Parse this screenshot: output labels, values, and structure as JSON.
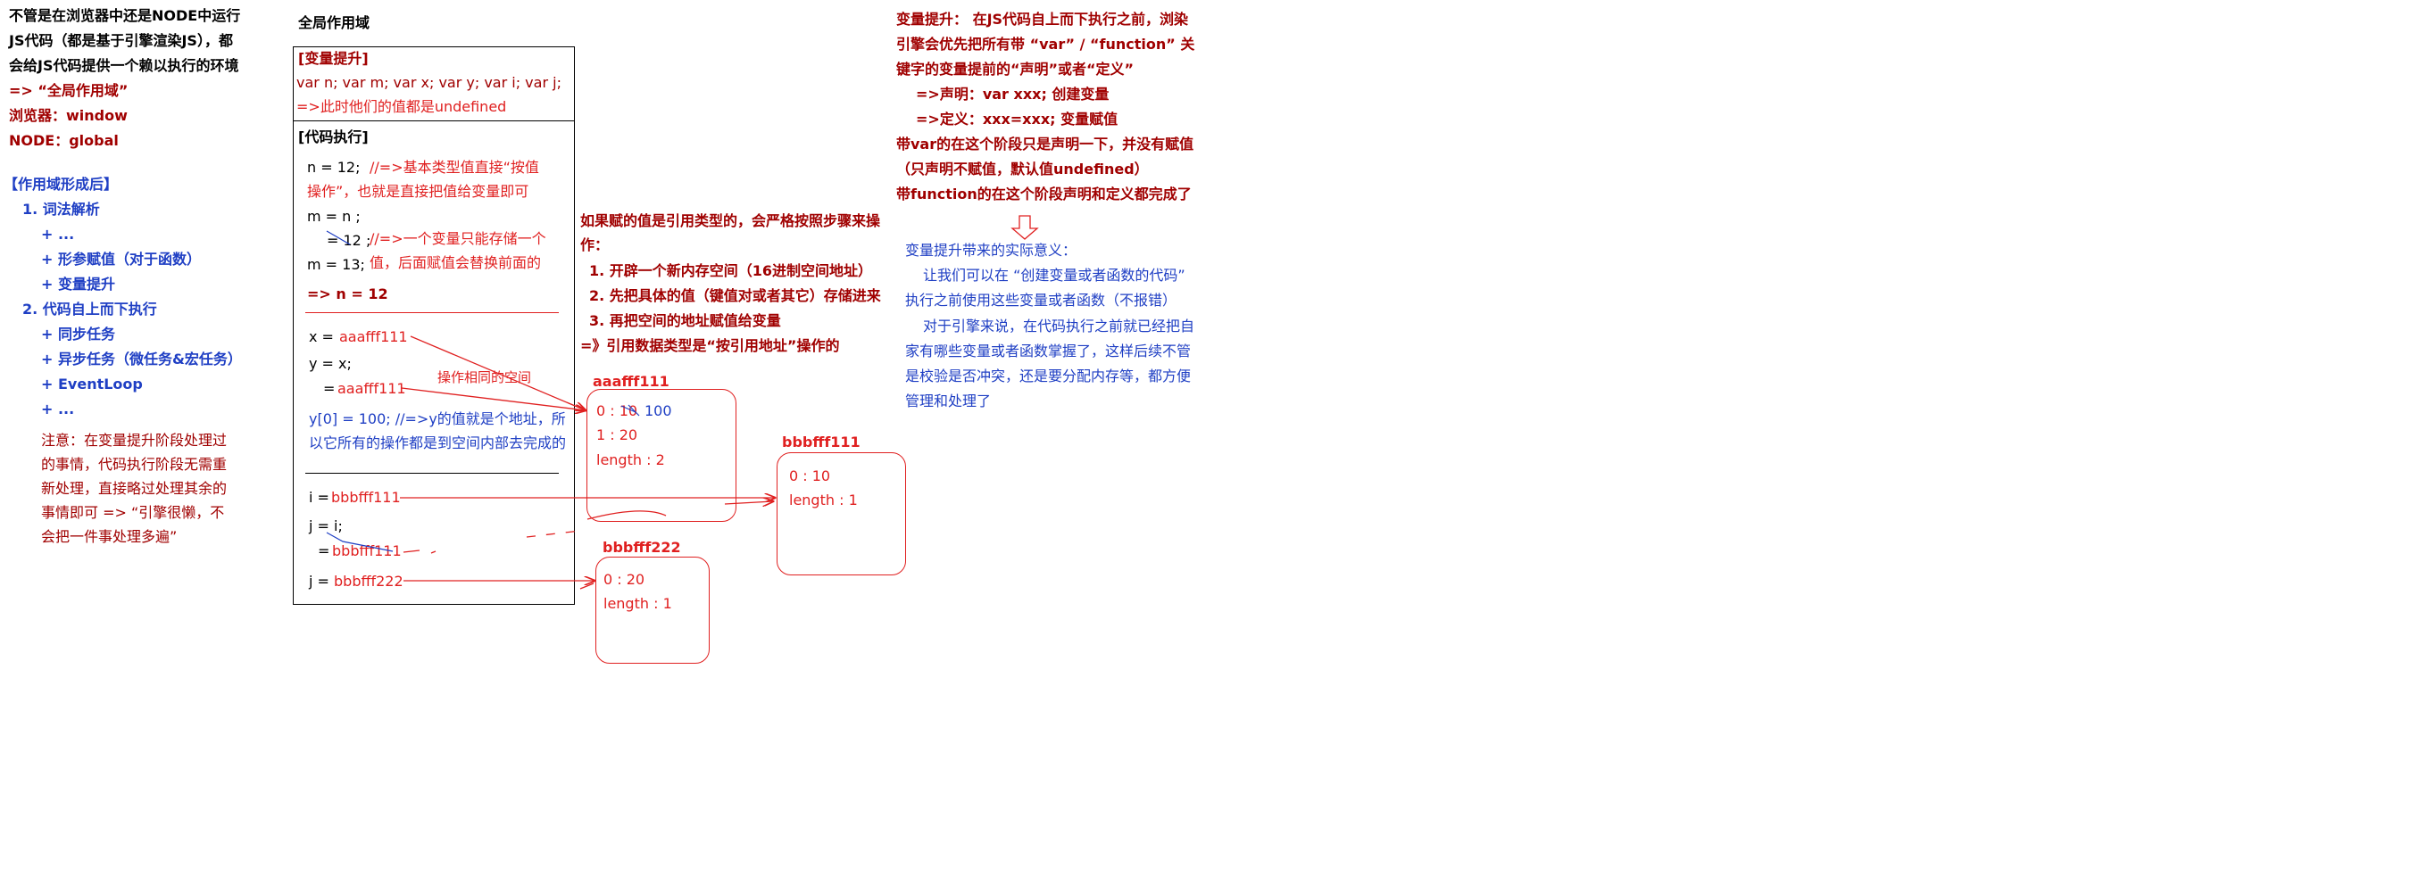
{
  "intro": {
    "lines": [
      "不管是在浏览器中还是NODE中运行",
      "JS代码（都是基于引擎渲染JS），都",
      "会给JS代码提供一个赖以执行的环境",
      "=> “全局作用域”",
      "浏览器：window",
      "NODE：global"
    ]
  },
  "after_scope": {
    "title": "【作用域形成后】",
    "items": [
      "1. 词法解析",
      "+ ...",
      "+ 形参赋值（对于函数）",
      "+ 变量提升",
      "2. 代码自上而下执行",
      "+ 同步任务",
      "+ 异步任务（微任务&宏任务）",
      "+ EventLoop",
      "+ ..."
    ],
    "note": [
      "注意：在变量提升阶段处理过",
      "的事情，代码执行阶段无需重",
      "新处理，直接略过处理其余的",
      "事情即可 => “引擎很懒，不",
      "会把一件事处理多遍”"
    ]
  },
  "global_scope": {
    "title": "全局作用域",
    "hoist_header": "[变量提升]",
    "hoist_line": "var n; var m; var x; var y; var i; var j;",
    "hoist_note": "=>此时他们的值都是undefined",
    "exec_header": "[代码执行]",
    "code": {
      "n_assign": "n = 12;",
      "n_comment_1": "//=>基本类型值直接“按值",
      "n_comment_2": "操作”，也就是直接把值给变量即可",
      "m_assign_1": "m = n ;",
      "m_assign_2": "= 12 ;",
      "m_comment_1": "//=>一个变量只能存储一个",
      "m_assign_3": "m = 13;",
      "m_comment_2": "值，后面赋值会替换前面的",
      "result": "=> n = 12",
      "x_label": "x =",
      "x_value": "aaafff111",
      "y_label": "y = x;",
      "y_eq": "=",
      "y_value": "aaafff111",
      "same_space": "操作相同的空间",
      "y0_line_1": "y[0] = 100;  //=>y的值就是个地址，所",
      "y0_line_2": "以它所有的操作都是到空间内部去完成的",
      "i_label": "i =",
      "i_value": "bbbfff111",
      "j1_label": "j = i;",
      "j1_eq": "=",
      "j1_value": "bbbfff111",
      "j2_label": "j =",
      "j2_value": "bbbfff222"
    }
  },
  "ref_steps": {
    "lines": [
      "如果赋的值是引用类型的，会严格按照步骤来操",
      "作：",
      "1. 开辟一个新内存空间（16进制空间地址）",
      "2. 先把具体的值（键值对或者其它）存储进来",
      "3. 再把空间的地址赋值给变量",
      "=》引用数据类型是“按引用地址”操作的"
    ]
  },
  "heaps": {
    "a": {
      "address": "aaafff111",
      "row1_old": "0 : 10",
      "row1_new": "100",
      "row2": "1 : 20",
      "row3": "length : 2"
    },
    "b": {
      "address": "bbbfff111",
      "row1": "0 : 10",
      "row2": "length : 1"
    },
    "c": {
      "address": "bbbfff222",
      "row1": "0 : 20",
      "row2": "length : 1"
    }
  },
  "hoisting": {
    "lines": [
      "变量提升：  在JS代码自上而下执行之前，浏染",
      "引擎会优先把所有带 “var” / “function” 关",
      "键字的变量提前的“声明”或者“定义”",
      "=>声明：var xxx;       创建变量",
      "=>定义：xxx=xxx;       变量赋值",
      "带var的在这个阶段只是声明一下，并没有赋值",
      "（只声明不赋值，默认值undefined）",
      "带function的在这个阶段声明和定义都完成了"
    ],
    "meaning_title": "变量提升带来的实际意义：",
    "meaning": [
      "让我们可以在 “创建变量或者函数的代码”",
      "执行之前使用这些变量或者函数（不报错）",
      "对于引擎来说，在代码执行之前就已经把自",
      "家有哪些变量或者函数掌握了，这样后续不管",
      "是校验是否冲突，还是要分配内存等，都方便",
      "管理和处理了"
    ]
  },
  "colors": {
    "dark_red": "#a00000",
    "red": "#e02020",
    "blue": "#1f3fc4"
  }
}
